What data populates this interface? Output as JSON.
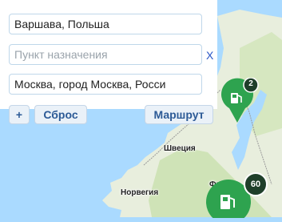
{
  "route_panel": {
    "origin_value": "Варшава, Польша",
    "destination_placeholder": "Пункт назначения",
    "clear_label": "X",
    "waypoint_value": "Москва, город Москва, Росси",
    "add_label": "+",
    "reset_label": "Сброс",
    "route_label": "Маршрут"
  },
  "map": {
    "labels": {
      "sweden": "Швеция",
      "norway": "Норвегия",
      "finland": "Финл"
    },
    "markers": [
      {
        "icon": "fuel-pump-icon",
        "count": "2"
      },
      {
        "icon": "fuel-pump-icon",
        "count": "60"
      }
    ],
    "colors": {
      "water": "#aadaff",
      "land": "#e8eedd",
      "forest": "#cfe3b7",
      "marker": "#2ea34f",
      "marker_badge": "#1f3f2a"
    }
  }
}
